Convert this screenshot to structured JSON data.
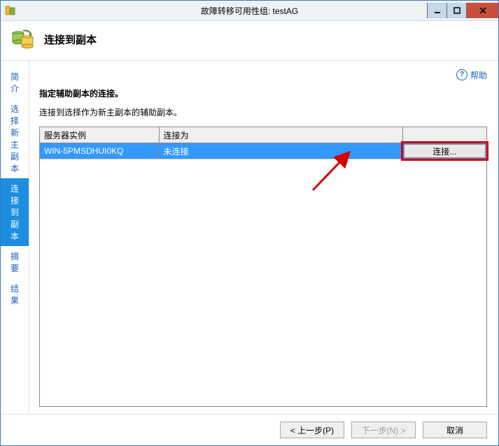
{
  "window": {
    "title": "故障转移可用性组: testAG"
  },
  "header": {
    "page_title": "连接到副本"
  },
  "sidebar": {
    "items": [
      {
        "label": "简介"
      },
      {
        "label": "选择新主副本"
      },
      {
        "label": "连接到副本"
      },
      {
        "label": "摘要"
      },
      {
        "label": "结果"
      }
    ]
  },
  "content": {
    "help_label": "帮助",
    "instruction": "指定辅助副本的连接。",
    "subtext": "连接到选择作为新主副本的辅助副本。",
    "columns": {
      "server": "服务器实例",
      "connect_as": "连接为"
    },
    "rows": [
      {
        "server": "WIN-5PMSDHUI0KQ",
        "connect_as": "未连接",
        "button_label": "连接..."
      }
    ]
  },
  "footer": {
    "prev": "< 上一步(P)",
    "next": "下一步(N) >",
    "cancel": "取消"
  }
}
